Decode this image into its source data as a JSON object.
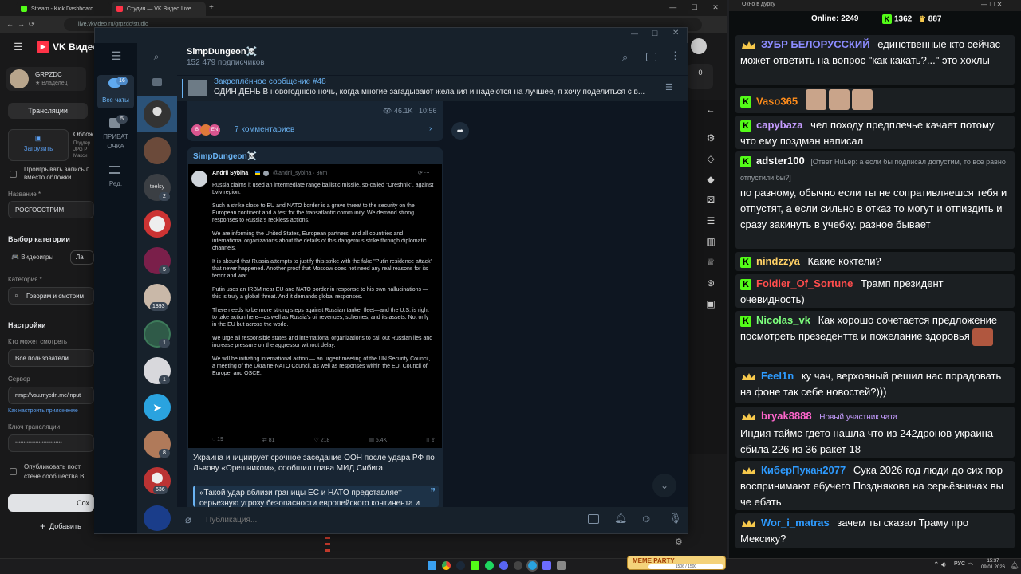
{
  "browser": {
    "tabs": [
      {
        "title": "Stream - Kick Dashboard",
        "color": "#53fc18"
      },
      {
        "title": "Студия — VK Видео Live",
        "color": "#ff3347"
      }
    ],
    "url": "live.vkvideo.ru/grpzdc/studio"
  },
  "vk": {
    "logo": "VK Видео",
    "channel": "GRPZDC",
    "role": "Владелец",
    "tab_streams": "Трансляции",
    "cover_label": "Облож",
    "cover_hint": "Поддер JPG P Макси",
    "upload_label": "Загрузить",
    "checkbox_cover": "Проигрывать запись п вместо обложки",
    "name_label": "Название *",
    "name_value": "РОСГОССТРИМ",
    "category_section": "Выбор категории",
    "cat_games": "Видеоигры",
    "cat_live": "Ла",
    "category_label": "Категория *",
    "category_value": "Говорим и смотрим",
    "settings": "Настройки",
    "who_label": "Кто может смотреть",
    "who_value": "Все пользователи",
    "server_label": "Сервер",
    "server_value": "rtmp://vsu.mycdn.me/input",
    "config_link": "Как настроить приложение",
    "key_label": "Ключ трансляции",
    "key_value": "••••••••••••••••••••••••••••",
    "publish_checkbox": "Опубликовать пост стене сообщества В",
    "save_btn": "Сох",
    "add_btn": "Добавить",
    "right_count": "0"
  },
  "tg": {
    "folders": [
      {
        "label": "Все чаты",
        "badge": "16"
      },
      {
        "label": "ПРИВАТ ОЧКА",
        "badge": "5"
      },
      {
        "label": "Ред.",
        "badge": ""
      }
    ],
    "chat_badges": [
      "2",
      "5",
      "1893",
      "1",
      "1",
      "8",
      "636"
    ],
    "chat_name": "SimpDungeon☠️",
    "subscribers": "152 479 подписчиков",
    "pinned_title": "Закреплённое сообщение #48",
    "pinned_text": "ОДИН ДЕНЬ  В новогоднюю ночь, когда многие загадывают желания и надеются на лучшее, я хочу поделиться с в...",
    "prev_views": "46.1K",
    "prev_time": "10:56",
    "comments": "7 комментариев",
    "post_author": "SimpDungeon☠️",
    "tweet": {
      "name": "Andrii Sybiha",
      "handle": "@andrii_sybiha · 36m",
      "paragraphs": [
        "Russia claims it used an intermediate range ballistic missile, so-called \"Oreshnik\", against Lviv region.",
        "Such a strike close to EU and NATO border is a grave threat to the security on the European continent and a test for the transatlantic community. We demand strong responses to Russia's reckless actions.",
        "We are informing the United States, European partners, and all countries and international organizations about the details of this dangerous strike through diplomatic channels.",
        "It is absurd that Russia attempts to justify this strike with the fake \"Putin residence attack\" that never happened. Another proof that Moscow does not need any real reasons for its terror and war.",
        "Putin uses an IRBM near EU and NATO border in response to his own hallucinations — this is truly a global threat. And it demands global responses.",
        "There needs to be more strong steps against Russian tanker fleet—and the U.S. is right to take action here—as well as Russia's oil revenues, schemes, and its assets. Not only in the EU but across the world.",
        "We urge all responsible states and international organizations to call out Russian lies and increase pressure on the aggressor without delay.",
        "We will be initiating international action — an urgent meeting of the UN Security Council, a meeting of the Ukraine-NATO Council, as well as responses within the EU, Council of Europe, and OSCE."
      ],
      "replies": "19",
      "reposts": "81",
      "likes": "218",
      "views": "5.4K"
    },
    "post_text": "Украина инициирует срочное заседание ООН после удара РФ по Львову «Орешником», сообщил глава МИД Сибига.",
    "quote": "«Такой удар вблизи границы ЕС и НАТО представляет серьезную угрозу безопасности европейского континента и",
    "input_placeholder": "Публикация..."
  },
  "kick": {
    "window_title": "Окно в дурку",
    "online_label": "Online:",
    "online_value": "2249",
    "stat1": "1362",
    "stat2": "887",
    "messages": [
      {
        "user": "ЗУБР БЕЛОРУССКИЙ",
        "color": "#8c8cff",
        "badge": "crown",
        "text": "единственные кто сейчас может ответить на вопрос \"как какать?...\" это хохлы"
      },
      {
        "user": "Vaso365",
        "color": "#ff8c1a",
        "badge": "kick",
        "text": ""
      },
      {
        "user": "capybaza",
        "color": "#c59cff",
        "badge": "kick",
        "text": "чел походу предплечье качает потому что ему поздман написал"
      },
      {
        "user": "adster100",
        "color": "#ffffff",
        "badge": "kick",
        "reply": "[Ответ HuLep: а если бы подписал допустим, то все равно отпустили бы?]",
        "text": "по разному, обычно если ты не сопративляешся тебя и отпустят, а если сильно в отказ то могут и отпиздить и сразу закинуть в учебку. разное бывает"
      },
      {
        "user": "nindzzya",
        "color": "#ffd166",
        "badge": "kick",
        "text": "Какие коктели?"
      },
      {
        "user": "Foldier_Of_Sortune",
        "color": "#ff4d4d",
        "badge": "kick",
        "text": "Трамп президент очевидность)"
      },
      {
        "user": "Nicolas_vk",
        "color": "#7dff7d",
        "badge": "kick",
        "text": "Как хорошо сочетается предложение посмотреть презедентта и пожелание здоровья"
      },
      {
        "user": "Feel1n",
        "color": "#2e9bff",
        "badge": "crown",
        "text": "ку чач, верховный решил нас порадовать на фоне так себе новостей?)))"
      },
      {
        "user": "bryak8888",
        "color": "#ff66cc",
        "badge": "crown",
        "tag": "Новый участник чата",
        "text": "Индия таймс гдето нашла что из 242дронов украина сбила 226 из 36 ракет 18"
      },
      {
        "user": "КиберПукан2077",
        "color": "#2e9bff",
        "badge": "crown",
        "text": "Сука 2026 год люди до сих пор воспринимают ебучего Позднякова на серьёзничах вы че ебать"
      },
      {
        "user": "Wor_i_matras",
        "color": "#2e9bff",
        "badge": "crown",
        "text": "зачем ты сказал Траму про Мексику?"
      }
    ]
  },
  "taskbar": {
    "meme": "MEME PARTY",
    "meme_sub": "1506 / 1500",
    "lang": "РУС",
    "time": "15:37",
    "date": "09.01.2026"
  }
}
